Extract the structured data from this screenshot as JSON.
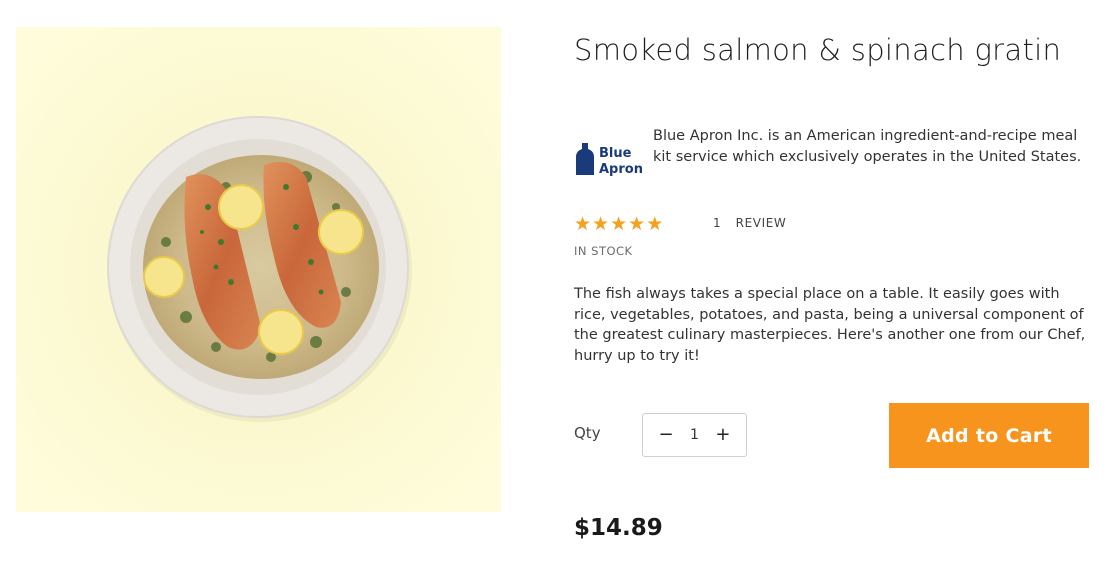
{
  "product": {
    "title": "Smoked salmon & spinach gratin",
    "brand_logo_text": [
      "Blue",
      "Apron"
    ],
    "brand_description": "Blue Apron Inc. is an American ingredient-and-recipe meal kit service which exclusively operates in the United States.",
    "rating": 5,
    "rating_max": 5,
    "review_count": "1",
    "review_label": "REVIEW",
    "stock_status": "IN STOCK",
    "description": "The fish always takes a special place on a table. It easily goes with rice, vegetables, potatoes, and pasta, being a universal component of the greatest culinary masterpieces. Here's another one from our Chef, hurry up to try it!",
    "price": "$14.89"
  },
  "quantity": {
    "label": "Qty",
    "value": "1",
    "decrement_symbol": "−",
    "increment_symbol": "+"
  },
  "cart": {
    "button_label": "Add to Cart"
  },
  "colors": {
    "accent": "#f7941d",
    "star": "#f4a11f",
    "brand_blue": "#1b3a7a",
    "image_background": "#fcf9d2"
  },
  "icons": {
    "star": "star-icon",
    "brand": "blue-apron-logo"
  }
}
